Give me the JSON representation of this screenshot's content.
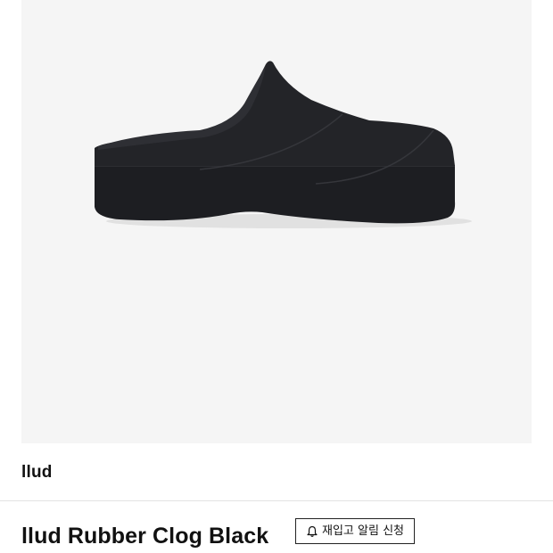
{
  "product": {
    "brand": "llud",
    "title": "llud Rubber Clog Black",
    "image_icon": "black-rubber-clog-image",
    "image_background": "#f5f5f5"
  },
  "restock": {
    "icon": "bell-icon",
    "label": "재입고 알림 신청"
  },
  "colors": {
    "text": "#111111",
    "divider": "#e2e2e2",
    "shoe": "#1c1d21"
  }
}
